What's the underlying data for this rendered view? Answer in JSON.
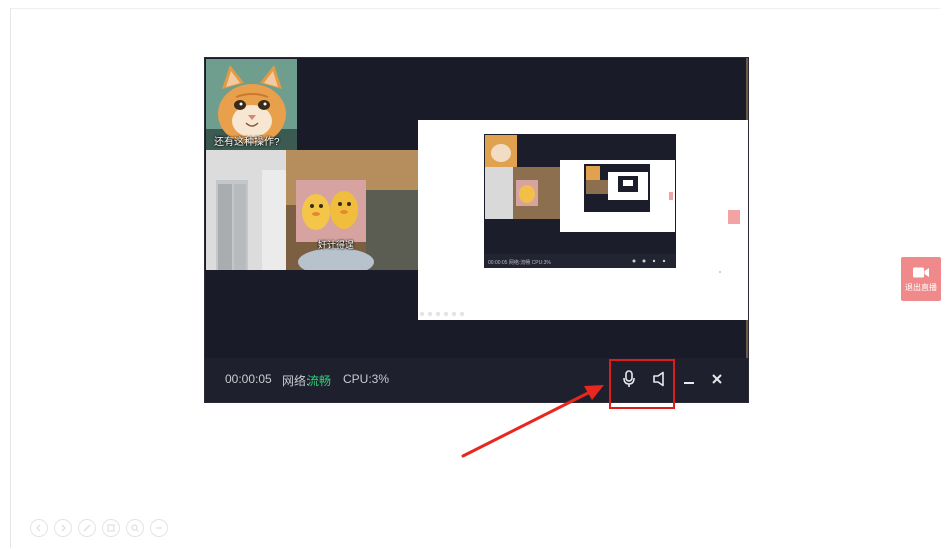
{
  "live_window": {
    "cat_caption": "还有这种操作?",
    "sticker_caption": "奸计得逞",
    "status": {
      "timer": "00:00:05",
      "network_label": "网络:",
      "network_value": "流畅",
      "cpu": "CPU:3%"
    },
    "controls": [
      "microphone-icon",
      "speaker-icon",
      "minimize-icon",
      "close-icon"
    ]
  },
  "nested_preview": {
    "status_text": "00:00:05 网络:流畅 CPU:3%"
  },
  "side_button": {
    "label": "退出直播"
  },
  "bottom_toolbar": {
    "icons": [
      "back-icon",
      "forward-icon",
      "edit-icon",
      "save-icon",
      "zoom-icon",
      "more-icon"
    ]
  },
  "colors": {
    "window_bg": "#1a1b28",
    "status_bar_bg": "#1f202d",
    "network_ok": "#2fd07a",
    "highlight": "#e01b1b",
    "side_button_bg": "#f08a8a"
  }
}
